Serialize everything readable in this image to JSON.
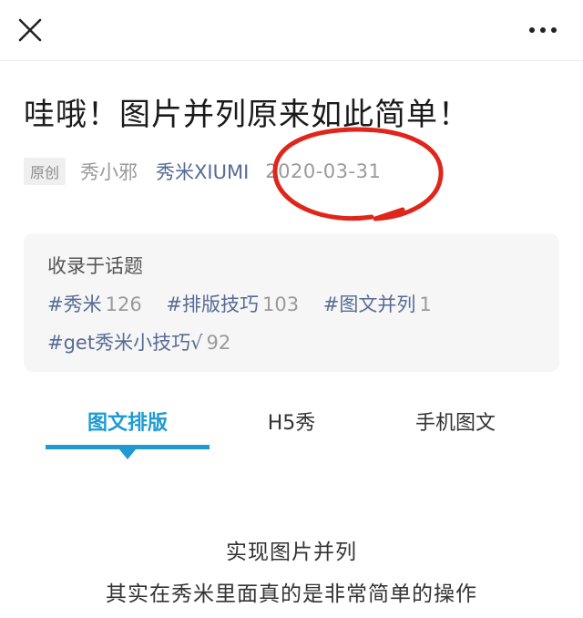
{
  "header": {
    "close_icon": "close-icon",
    "more_icon": "more-dots-icon"
  },
  "article": {
    "title": "哇哦！图片并列原来如此简单！",
    "original_tag": "原创",
    "author": "秀小邪",
    "account": "秀米XIUMI",
    "date": "2020-03-31"
  },
  "topics": {
    "heading": "收录于话题",
    "row1": [
      {
        "name": "#秀米",
        "count": "126"
      },
      {
        "name": "#排版技巧",
        "count": "103"
      },
      {
        "name": "#图文并列",
        "count": "1"
      }
    ],
    "row2": [
      {
        "name": "#get秀米小技巧√",
        "count": "92"
      }
    ]
  },
  "tabs": [
    {
      "label": "图文排版",
      "active": true
    },
    {
      "label": "H5秀",
      "active": false
    },
    {
      "label": "手机图文",
      "active": false
    }
  ],
  "content": {
    "line1": "实现图片并列",
    "line2": "其实在秀米里面真的是非常简单的操作"
  },
  "colors": {
    "link": "#576b95",
    "accent": "#1e9bd1",
    "annotation_circle": "#e0261b"
  }
}
